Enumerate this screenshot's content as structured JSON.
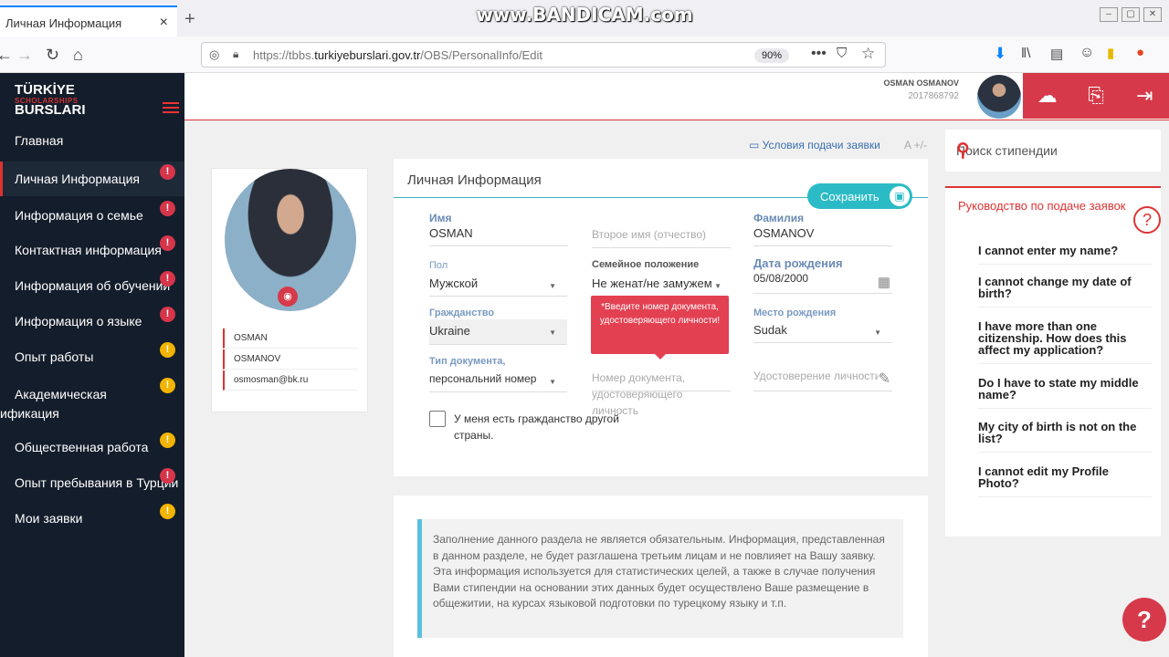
{
  "browser": {
    "tab_title": "Личная Информация",
    "tab_close": "×",
    "new_tab": "+",
    "watermark": "www.BANDICAM.com",
    "url_prefix": "https://tbbs.",
    "url_domain": "turkiyeburslari.gov.tr",
    "url_path": "/OBS/PersonalInfo/Edit",
    "zoom": "90%"
  },
  "logo": {
    "line1": "TÜRKİYE",
    "line2": "SCHOLARSHIPS",
    "line3": "BURSLARI"
  },
  "sidebar": {
    "items": [
      {
        "label": "Главная",
        "badge": ""
      },
      {
        "label": "Личная Информация",
        "badge": "!"
      },
      {
        "label": "Информация о семье",
        "badge": "!"
      },
      {
        "label": "Контактная информация",
        "badge": "!"
      },
      {
        "label": "Информация об обучении",
        "badge": "!"
      },
      {
        "label": "Информация о языке",
        "badge": "!"
      },
      {
        "label": "Опыт работы",
        "badge": "!"
      },
      {
        "label": "Академическая",
        "label2": "ификация",
        "badge": "!"
      },
      {
        "label": "Общественная работа",
        "badge": "!"
      },
      {
        "label": "Опыт пребывания в Турции",
        "badge": "!"
      },
      {
        "label": "Мои заявки",
        "badge": "!"
      }
    ]
  },
  "header": {
    "user_name": "OSMAN OSMANOV",
    "user_id": "2017868792"
  },
  "profile": {
    "first_name": "OSMAN",
    "last_name": "OSMANOV",
    "email": "osmosman@bk.ru"
  },
  "links": {
    "conditions": "Условия подачи заявки",
    "font_size": "A +/-"
  },
  "form": {
    "title": "Личная Информация",
    "save": "Сохранить",
    "first_name_label": "Имя",
    "first_name_value": "OSMAN",
    "middle_name_placeholder": "Второе имя (отчество)",
    "last_name_label": "Фамилия",
    "last_name_value": "OSMANOV",
    "gender_label": "Пол",
    "gender_value": "Мужской",
    "marital_label": "Семейное положение",
    "marital_value": "Не женат/не замужем",
    "birthdate_label": "Дата рождения",
    "birthdate_value": "05/08/2000",
    "citizenship_label": "Гражданство",
    "citizenship_value": "Ukraine",
    "birthplace_label": "Место рождения",
    "birthplace_value": "Sudak",
    "doc_type_label": "Тип документа,",
    "doc_type_value": "персональний номер",
    "doc_number_placeholder": "Номер документа, удостоверяющего личность",
    "id_placeholder": "Удостоверение личности",
    "tooltip": "*Введите номер документа, удостоверяющего личности!",
    "dual_citizenship_label": "У меня есть гражданство другой страны."
  },
  "info_text": "Заполнение данного раздела не является обязательным. Информация, представленная в данном разделе, не будет разглашена третьим лицам и не повлияет на Вашу заявку. Эта информация используется для статистических целей, а также в случае получения Вами стипендии на основании этих данных будет осуществлено Ваше размещение в общежитии, на курсах языковой подготовки по турецкому языку и т.п.",
  "right": {
    "search_placeholder": "Поиск стипендии",
    "guide_title": "Руководство по подаче заявок",
    "faq": [
      "I cannot enter my name?",
      "I cannot change my date of birth?",
      "I have more than one citizenship. How does this affect my application?",
      "Do I have to state my middle name?",
      "My city of birth is not on the list?",
      "I cannot edit my Profile Photo?"
    ]
  },
  "help_fab": "?",
  "colors": {
    "sidebar": "#141d2b",
    "accent_red": "#d63a4a",
    "teal": "#2bbbc6",
    "badge_yellow": "#f2b400"
  }
}
